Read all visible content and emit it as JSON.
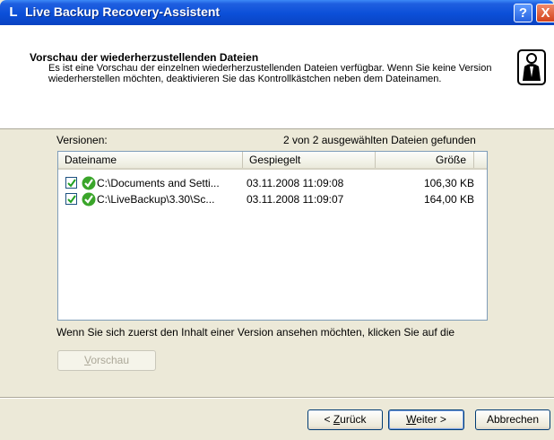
{
  "window": {
    "title": "Live Backup Recovery-Assistent",
    "app_icon_glyph": "L",
    "help_glyph": "?",
    "close_glyph": "X"
  },
  "header": {
    "title": "Vorschau der wiederherzustellenden Dateien",
    "description": "Es ist eine Vorschau der einzelnen wiederherzustellenden Dateien verfügbar. Wenn Sie keine Version wiederherstellen möchten, deaktivieren Sie das Kontrollkästchen neben dem Dateinamen.",
    "icon": "wizard-person-icon"
  },
  "main": {
    "versions_label": "Versionen:",
    "found_label": "2 von 2 ausgewählten Dateien gefunden",
    "columns": [
      "Dateiname",
      "Gespiegelt",
      "Größe"
    ],
    "rows": [
      {
        "checked": true,
        "icon": "green-check-icon",
        "name": "C:\\Documents and Setti...",
        "date": "03.11.2008 11:09:08",
        "size": "106,30 KB"
      },
      {
        "checked": true,
        "icon": "green-check-icon",
        "name": "C:\\LiveBackup\\3.30\\Sc...",
        "date": "03.11.2008 11:09:07",
        "size": "164,00 KB"
      }
    ],
    "hint": "Wenn Sie sich zuerst den Inhalt einer Version ansehen möchten, klicken Sie auf die",
    "preview_button": {
      "mnemonic": "V",
      "rest": "orschau"
    }
  },
  "footer": {
    "back": {
      "prefix": "< ",
      "mnemonic": "Z",
      "rest": "urück"
    },
    "next": {
      "mnemonic": "W",
      "rest": "eiter >"
    },
    "cancel": "Abbrechen"
  },
  "colors": {
    "titlebar": "#0b4fd8",
    "dialog_bg": "#ece9d8",
    "check_green": "#3aa52a"
  }
}
